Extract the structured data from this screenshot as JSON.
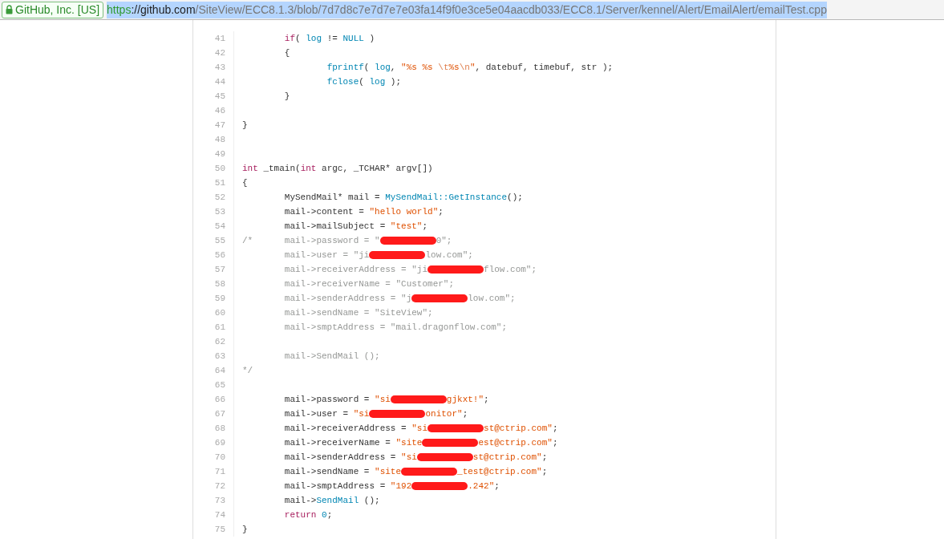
{
  "address_bar": {
    "identity": "GitHub, Inc. [US]",
    "url_scheme": "https",
    "url_host": "://github.com",
    "url_path": "/SiteView/ECC8.1.3/blob/7d7d8c7e7d7e7e03fa14f9f0e3ce5e04aacdb033/ECC8.1/Server/kennel/Alert/EmailAlert/emailTest.cpp"
  },
  "code_lines": [
    {
      "number": "41",
      "segments": [
        {
          "kind": "keyword",
          "text": "\tif"
        },
        {
          "kind": "plain",
          "text": "( "
        },
        {
          "kind": "function",
          "text": "log"
        },
        {
          "kind": "plain",
          "text": " != "
        },
        {
          "kind": "function",
          "text": "NULL"
        },
        {
          "kind": "plain",
          "text": " )"
        }
      ]
    },
    {
      "number": "42",
      "segments": [
        {
          "kind": "plain",
          "text": "\t{"
        }
      ]
    },
    {
      "number": "43",
      "segments": [
        {
          "kind": "function",
          "text": "\t\tfprintf"
        },
        {
          "kind": "plain",
          "text": "( "
        },
        {
          "kind": "function",
          "text": "log"
        },
        {
          "kind": "plain",
          "text": ", "
        },
        {
          "kind": "string",
          "text": "\"%s %s "
        },
        {
          "kind": "escape",
          "text": "\\t"
        },
        {
          "kind": "string",
          "text": "%s"
        },
        {
          "kind": "escape",
          "text": "\\n"
        },
        {
          "kind": "string",
          "text": "\""
        },
        {
          "kind": "plain",
          "text": ", datebuf, timebuf, str );"
        }
      ]
    },
    {
      "number": "44",
      "segments": [
        {
          "kind": "function",
          "text": "\t\tfclose"
        },
        {
          "kind": "plain",
          "text": "( "
        },
        {
          "kind": "function",
          "text": "log"
        },
        {
          "kind": "plain",
          "text": " );"
        }
      ]
    },
    {
      "number": "45",
      "segments": [
        {
          "kind": "plain",
          "text": "\t}"
        }
      ]
    },
    {
      "number": "46"
    },
    {
      "number": "47",
      "segments": [
        {
          "kind": "plain",
          "text": "}"
        }
      ]
    },
    {
      "number": "48"
    },
    {
      "number": "49"
    },
    {
      "number": "50",
      "segments": [
        {
          "kind": "keyword",
          "text": "int"
        },
        {
          "kind": "plain",
          "text": " _tmain("
        },
        {
          "kind": "keyword",
          "text": "int"
        },
        {
          "kind": "plain",
          "text": " argc, _TCHAR* argv[])"
        }
      ]
    },
    {
      "number": "51",
      "segments": [
        {
          "kind": "plain",
          "text": "{"
        }
      ]
    },
    {
      "number": "52",
      "segments": [
        {
          "kind": "plain",
          "text": "\tMySendMail* mail = "
        },
        {
          "kind": "function",
          "text": "MySendMail::GetInstance"
        },
        {
          "kind": "plain",
          "text": "();"
        }
      ]
    },
    {
      "number": "53",
      "segments": [
        {
          "kind": "plain",
          "text": "\tmail->content = "
        },
        {
          "kind": "string",
          "text": "\"hello world\""
        },
        {
          "kind": "plain",
          "text": ";"
        }
      ]
    },
    {
      "number": "54",
      "segments": [
        {
          "kind": "plain",
          "text": "\tmail->mailSubject = "
        },
        {
          "kind": "string",
          "text": "\"test\""
        },
        {
          "kind": "plain",
          "text": ";"
        }
      ]
    },
    {
      "number": "55",
      "segments": [
        {
          "kind": "comment",
          "text": "/*\tmail->password = \""
        },
        {
          "kind": "redaction"
        },
        {
          "kind": "comment",
          "text": "0\";"
        }
      ]
    },
    {
      "number": "56",
      "segments": [
        {
          "kind": "comment",
          "text": "\tmail->user = \"ji"
        },
        {
          "kind": "redaction"
        },
        {
          "kind": "comment",
          "text": "low.com\";"
        }
      ]
    },
    {
      "number": "57",
      "segments": [
        {
          "kind": "comment",
          "text": "\tmail->receiverAddress = \"ji"
        },
        {
          "kind": "redaction"
        },
        {
          "kind": "comment",
          "text": "flow.com\";"
        }
      ]
    },
    {
      "number": "58",
      "segments": [
        {
          "kind": "comment",
          "text": "\tmail->receiverName = \"Customer\";"
        }
      ]
    },
    {
      "number": "59",
      "segments": [
        {
          "kind": "comment",
          "text": "\tmail->senderAddress = \"j"
        },
        {
          "kind": "redaction"
        },
        {
          "kind": "comment",
          "text": "low.com\";"
        }
      ]
    },
    {
      "number": "60",
      "segments": [
        {
          "kind": "comment",
          "text": "\tmail->sendName = \"SiteView\";"
        }
      ]
    },
    {
      "number": "61",
      "segments": [
        {
          "kind": "comment",
          "text": "\tmail->smptAddress = \"mail.dragonflow.com\";"
        }
      ]
    },
    {
      "number": "62"
    },
    {
      "number": "63",
      "segments": [
        {
          "kind": "comment",
          "text": "\tmail->SendMail ();"
        }
      ]
    },
    {
      "number": "64",
      "segments": [
        {
          "kind": "comment",
          "text": "*/"
        }
      ]
    },
    {
      "number": "65"
    },
    {
      "number": "66",
      "segments": [
        {
          "kind": "plain",
          "text": "\tmail->password = "
        },
        {
          "kind": "string",
          "text": "\"si"
        },
        {
          "kind": "redaction"
        },
        {
          "kind": "string",
          "text": "gjkxt!\""
        },
        {
          "kind": "plain",
          "text": ";"
        }
      ]
    },
    {
      "number": "67",
      "segments": [
        {
          "kind": "plain",
          "text": "\tmail->user = "
        },
        {
          "kind": "string",
          "text": "\"si"
        },
        {
          "kind": "redaction"
        },
        {
          "kind": "string",
          "text": "onitor\""
        },
        {
          "kind": "plain",
          "text": ";"
        }
      ]
    },
    {
      "number": "68",
      "segments": [
        {
          "kind": "plain",
          "text": "\tmail->receiverAddress = "
        },
        {
          "kind": "string",
          "text": "\"si"
        },
        {
          "kind": "redaction"
        },
        {
          "kind": "string",
          "text": "st@ctrip.com\""
        },
        {
          "kind": "plain",
          "text": ";"
        }
      ]
    },
    {
      "number": "69",
      "segments": [
        {
          "kind": "plain",
          "text": "\tmail->receiverName = "
        },
        {
          "kind": "string",
          "text": "\"site"
        },
        {
          "kind": "redaction"
        },
        {
          "kind": "string",
          "text": "est@ctrip.com\""
        },
        {
          "kind": "plain",
          "text": ";"
        }
      ]
    },
    {
      "number": "70",
      "segments": [
        {
          "kind": "plain",
          "text": "\tmail->senderAddress = "
        },
        {
          "kind": "string",
          "text": "\"si"
        },
        {
          "kind": "redaction"
        },
        {
          "kind": "string",
          "text": "st@ctrip.com\""
        },
        {
          "kind": "plain",
          "text": ";"
        }
      ]
    },
    {
      "number": "71",
      "segments": [
        {
          "kind": "plain",
          "text": "\tmail->sendName = "
        },
        {
          "kind": "string",
          "text": "\"site"
        },
        {
          "kind": "redaction"
        },
        {
          "kind": "string",
          "text": "_test@ctrip.com\""
        },
        {
          "kind": "plain",
          "text": ";"
        }
      ]
    },
    {
      "number": "72",
      "segments": [
        {
          "kind": "plain",
          "text": "\tmail->smptAddress = "
        },
        {
          "kind": "string",
          "text": "\"192"
        },
        {
          "kind": "redaction"
        },
        {
          "kind": "string",
          "text": ".242\""
        },
        {
          "kind": "plain",
          "text": ";"
        }
      ]
    },
    {
      "number": "73",
      "segments": [
        {
          "kind": "plain",
          "text": "\tmail->"
        },
        {
          "kind": "function",
          "text": "SendMail"
        },
        {
          "kind": "plain",
          "text": " ();"
        }
      ]
    },
    {
      "number": "74",
      "segments": [
        {
          "kind": "keyword",
          "text": "\treturn "
        },
        {
          "kind": "number",
          "text": "0"
        },
        {
          "kind": "plain",
          "text": ";"
        }
      ]
    },
    {
      "number": "75",
      "segments": [
        {
          "kind": "plain",
          "text": "}"
        }
      ]
    }
  ]
}
